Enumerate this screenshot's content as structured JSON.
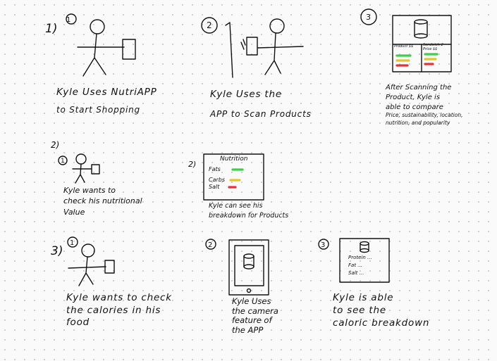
{
  "storyboard": {
    "row1": {
      "panel1": {
        "number": "1)",
        "caption_line1": "Kyle Uses NutriAPP",
        "caption_line2": "to Start Shopping"
      },
      "panel2": {
        "caption_line1": "Kyle Uses the",
        "caption_line2": "APP to Scan Products"
      },
      "panel3": {
        "screen_label_left": "Product $$",
        "screen_label_right": "Sandwich 2 Price $$",
        "caption_lines": [
          "After Scanning the",
          "Product, Kyle is",
          "able to compare",
          "Price, sustainability, location,",
          "nutrition, and popularity"
        ]
      }
    },
    "row2": {
      "number": "2)",
      "panel1": {
        "caption_lines": [
          "Kyle wants to",
          "check his nutritional",
          "Value"
        ]
      },
      "panel2": {
        "number": "2)",
        "screen_title": "Nutrition",
        "screen_rows": [
          {
            "label": "Fats",
            "color": "#3fcf4a"
          },
          {
            "label": "Carbs",
            "color": "#e3c62a"
          },
          {
            "label": "Salt",
            "color": "#e0343a"
          }
        ],
        "caption_lines": [
          "Kyle can see his",
          "breakdown for Products"
        ]
      }
    },
    "row3": {
      "number": "3)",
      "panel1": {
        "caption_lines": [
          "Kyle wants to check",
          "the calories in his",
          "food"
        ]
      },
      "panel2": {
        "caption_lines": [
          "Kyle Uses",
          "the camera",
          "feature of",
          "the APP"
        ]
      },
      "panel3": {
        "screen_rows": [
          "Protein ...",
          "Fat ...",
          "Salt ..."
        ],
        "caption_lines": [
          "Kyle is able",
          "to see the",
          "caloric breakdown"
        ]
      }
    }
  }
}
